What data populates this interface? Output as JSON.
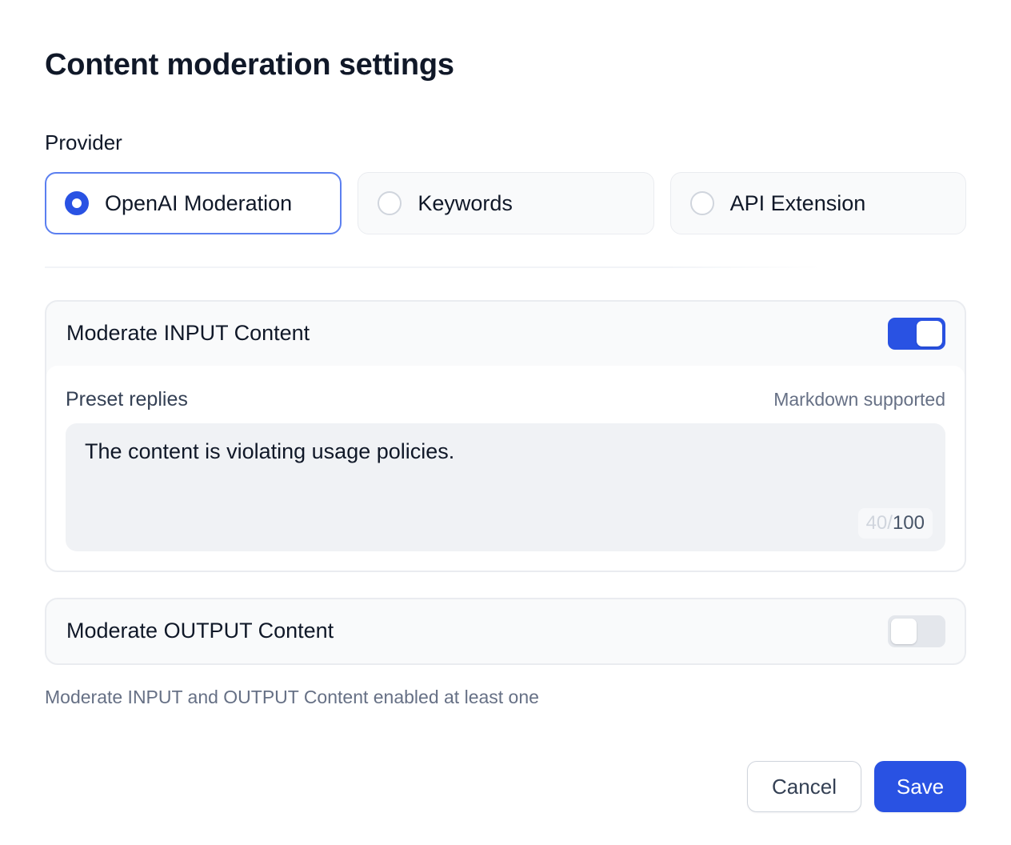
{
  "dialog": {
    "title": "Content moderation settings"
  },
  "provider": {
    "label": "Provider",
    "options": [
      {
        "label": "OpenAI Moderation",
        "selected": true
      },
      {
        "label": "Keywords",
        "selected": false
      },
      {
        "label": "API Extension",
        "selected": false
      }
    ]
  },
  "input_moderation": {
    "title": "Moderate INPUT Content",
    "enabled": true,
    "preset_label": "Preset replies",
    "markdown_hint": "Markdown supported",
    "preset_reply": "The content is violating usage policies.",
    "char_count": "40",
    "char_separator": "/",
    "char_max": "100"
  },
  "output_moderation": {
    "title": "Moderate OUTPUT Content",
    "enabled": false
  },
  "hint": "Moderate INPUT and OUTPUT Content enabled at least one",
  "actions": {
    "cancel_label": "Cancel",
    "save_label": "Save"
  },
  "colors": {
    "accent": "#2952e3",
    "selected_border": "#5b7ff0",
    "panel_bg": "#f9fafb",
    "toggle_off": "#e4e7ec"
  }
}
